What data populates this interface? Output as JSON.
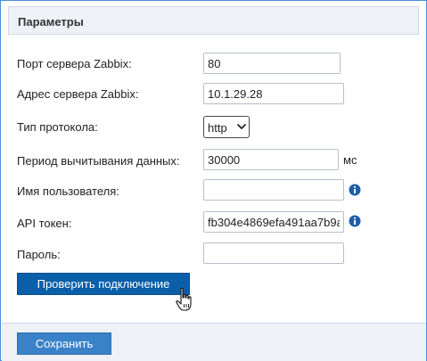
{
  "panel": {
    "title": "Параметры"
  },
  "form": {
    "zabbix_port": {
      "label": "Порт сервера Zabbix:",
      "value": "80"
    },
    "zabbix_address": {
      "label": "Адрес сервера Zabbix:",
      "value": "10.1.29.28"
    },
    "protocol": {
      "label": "Тип протокола:",
      "selected": "http"
    },
    "poll_period": {
      "label": "Период вычитывания данных:",
      "value": "30000",
      "unit": "мс"
    },
    "username": {
      "label": "Имя пользователя:",
      "value": ""
    },
    "api_token": {
      "label": "API токен:",
      "value": "fb304e4869efa491aa7b9a"
    },
    "password": {
      "label": "Пароль:",
      "value": ""
    }
  },
  "buttons": {
    "test_connection": "Проверить подключение",
    "save": "Сохранить"
  },
  "icons": {
    "info": "info-icon",
    "chevron": "chevron-down-icon",
    "cursor": "hand-cursor-icon"
  },
  "colors": {
    "accent": "#0a5fa8",
    "save_button": "#3a82c8",
    "info_icon": "#1e5fa8",
    "header_bg": "#eef1f6"
  }
}
